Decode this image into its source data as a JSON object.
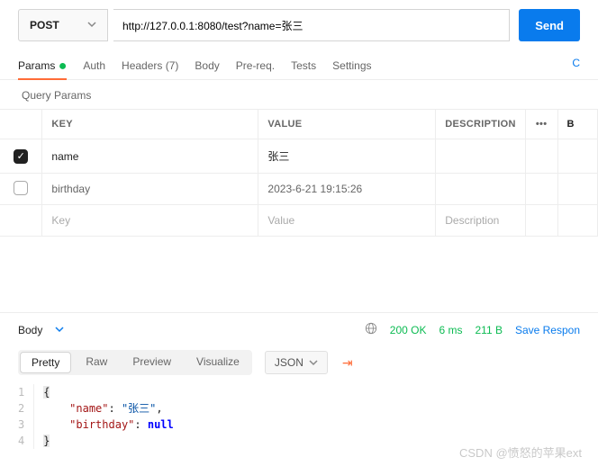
{
  "request": {
    "method": "POST",
    "url": "http://127.0.0.1:8080/test?name=张三",
    "send_label": "Send"
  },
  "tabs": {
    "params": "Params",
    "auth": "Auth",
    "headers": "Headers (7)",
    "body": "Body",
    "prereq": "Pre-req.",
    "tests": "Tests",
    "settings": "Settings",
    "cookies": "C"
  },
  "section_title": "Query Params",
  "columns": {
    "key": "KEY",
    "value": "VALUE",
    "desc": "DESCRIPTION",
    "bulk": "B"
  },
  "rows": [
    {
      "checked": true,
      "key": "name",
      "value": "张三",
      "desc": "",
      "enabled": true
    },
    {
      "checked": false,
      "key": "birthday",
      "value": "2023-6-21 19:15:26",
      "desc": "",
      "enabled": false
    }
  ],
  "placeholders": {
    "key": "Key",
    "value": "Value",
    "desc": "Description"
  },
  "response": {
    "tab_label": "Body",
    "status": "200 OK",
    "time": "6 ms",
    "size": "211 B",
    "save": "Save Respon"
  },
  "viewer": {
    "pretty": "Pretty",
    "raw": "Raw",
    "preview": "Preview",
    "visualize": "Visualize",
    "format": "JSON"
  },
  "body_json": {
    "line1": "{",
    "line2_key": "\"name\"",
    "line2_val": "\"张三\"",
    "line3_key": "\"birthday\"",
    "line3_val": "null",
    "line4": "}"
  },
  "watermark": "CSDN @愤怒的苹果ext"
}
